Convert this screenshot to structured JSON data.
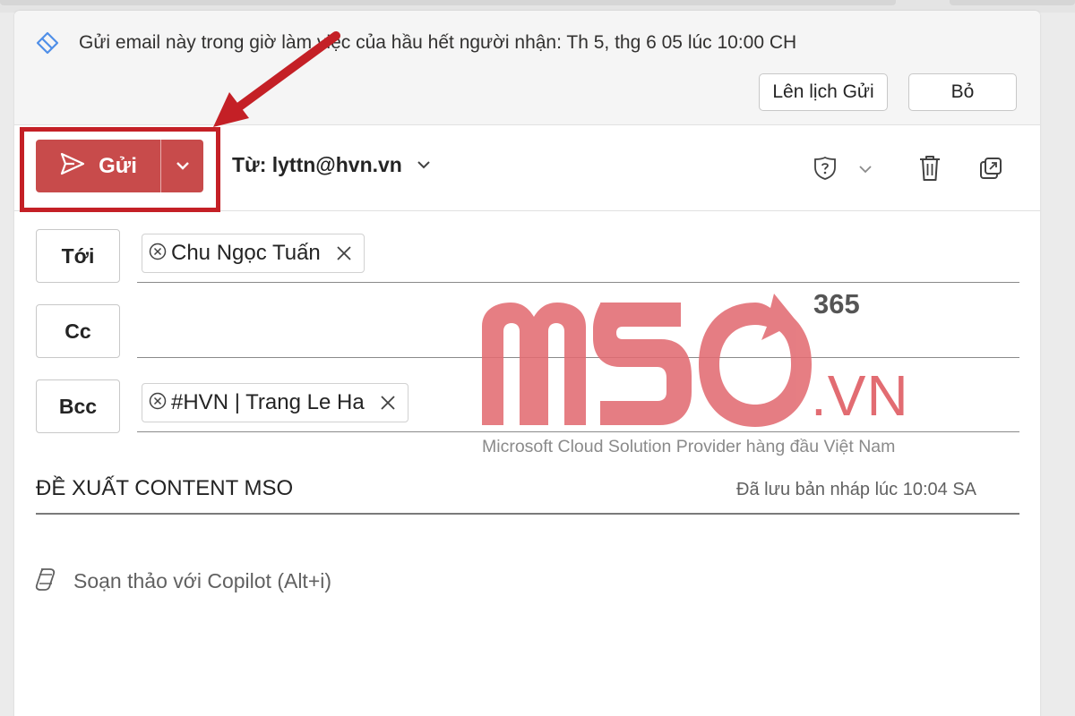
{
  "banner": {
    "text": "Gửi email này trong giờ làm việc của hầu hết người nhận: Th 5, thg 6 05 lúc 10:00 CH",
    "schedule_button": "Lên lịch Gửi",
    "discard_button": "Bỏ"
  },
  "toolbar": {
    "send_label": "Gửi",
    "from_label": "Từ: lyttn@hvn.vn",
    "icons": [
      "sensitivity-icon",
      "chevron-down-icon",
      "delete-icon",
      "pop-out-icon"
    ]
  },
  "recipients": {
    "to": {
      "label": "Tới",
      "chips": [
        "Chu Ngọc Tuấn"
      ]
    },
    "cc": {
      "label": "Cc",
      "chips": []
    },
    "bcc": {
      "label": "Bcc",
      "chips": [
        "#HVN | Trang Le Ha"
      ]
    }
  },
  "subject": {
    "text": "ĐỀ XUẤT CONTENT MSO",
    "saved_status": "Đã lưu bản nháp lúc 10:04 SA"
  },
  "copilot": {
    "label": "Soạn thảo với Copilot (Alt+i)"
  },
  "watermark": {
    "brand": "MSO",
    "domain": ".VN",
    "superscript": "365",
    "tagline": "Microsoft Cloud Solution Provider hàng đầu Việt Nam"
  },
  "colors": {
    "send_button": "#c84b4b",
    "highlight": "#c42026",
    "watermark": "#e26c72"
  }
}
